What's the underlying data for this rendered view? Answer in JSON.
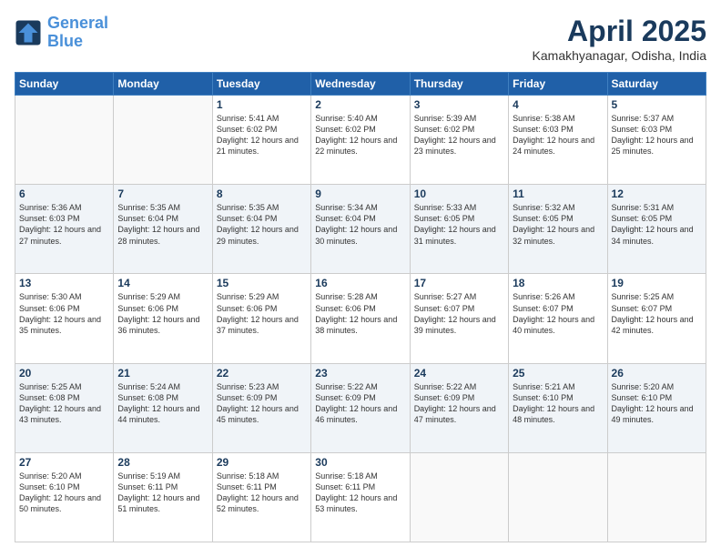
{
  "header": {
    "logo_line1": "General",
    "logo_line2": "Blue",
    "month": "April 2025",
    "location": "Kamakhyanagar, Odisha, India"
  },
  "days_of_week": [
    "Sunday",
    "Monday",
    "Tuesday",
    "Wednesday",
    "Thursday",
    "Friday",
    "Saturday"
  ],
  "weeks": [
    [
      {
        "day": "",
        "text": ""
      },
      {
        "day": "",
        "text": ""
      },
      {
        "day": "1",
        "text": "Sunrise: 5:41 AM\nSunset: 6:02 PM\nDaylight: 12 hours and 21 minutes."
      },
      {
        "day": "2",
        "text": "Sunrise: 5:40 AM\nSunset: 6:02 PM\nDaylight: 12 hours and 22 minutes."
      },
      {
        "day": "3",
        "text": "Sunrise: 5:39 AM\nSunset: 6:02 PM\nDaylight: 12 hours and 23 minutes."
      },
      {
        "day": "4",
        "text": "Sunrise: 5:38 AM\nSunset: 6:03 PM\nDaylight: 12 hours and 24 minutes."
      },
      {
        "day": "5",
        "text": "Sunrise: 5:37 AM\nSunset: 6:03 PM\nDaylight: 12 hours and 25 minutes."
      }
    ],
    [
      {
        "day": "6",
        "text": "Sunrise: 5:36 AM\nSunset: 6:03 PM\nDaylight: 12 hours and 27 minutes."
      },
      {
        "day": "7",
        "text": "Sunrise: 5:35 AM\nSunset: 6:04 PM\nDaylight: 12 hours and 28 minutes."
      },
      {
        "day": "8",
        "text": "Sunrise: 5:35 AM\nSunset: 6:04 PM\nDaylight: 12 hours and 29 minutes."
      },
      {
        "day": "9",
        "text": "Sunrise: 5:34 AM\nSunset: 6:04 PM\nDaylight: 12 hours and 30 minutes."
      },
      {
        "day": "10",
        "text": "Sunrise: 5:33 AM\nSunset: 6:05 PM\nDaylight: 12 hours and 31 minutes."
      },
      {
        "day": "11",
        "text": "Sunrise: 5:32 AM\nSunset: 6:05 PM\nDaylight: 12 hours and 32 minutes."
      },
      {
        "day": "12",
        "text": "Sunrise: 5:31 AM\nSunset: 6:05 PM\nDaylight: 12 hours and 34 minutes."
      }
    ],
    [
      {
        "day": "13",
        "text": "Sunrise: 5:30 AM\nSunset: 6:06 PM\nDaylight: 12 hours and 35 minutes."
      },
      {
        "day": "14",
        "text": "Sunrise: 5:29 AM\nSunset: 6:06 PM\nDaylight: 12 hours and 36 minutes."
      },
      {
        "day": "15",
        "text": "Sunrise: 5:29 AM\nSunset: 6:06 PM\nDaylight: 12 hours and 37 minutes."
      },
      {
        "day": "16",
        "text": "Sunrise: 5:28 AM\nSunset: 6:06 PM\nDaylight: 12 hours and 38 minutes."
      },
      {
        "day": "17",
        "text": "Sunrise: 5:27 AM\nSunset: 6:07 PM\nDaylight: 12 hours and 39 minutes."
      },
      {
        "day": "18",
        "text": "Sunrise: 5:26 AM\nSunset: 6:07 PM\nDaylight: 12 hours and 40 minutes."
      },
      {
        "day": "19",
        "text": "Sunrise: 5:25 AM\nSunset: 6:07 PM\nDaylight: 12 hours and 42 minutes."
      }
    ],
    [
      {
        "day": "20",
        "text": "Sunrise: 5:25 AM\nSunset: 6:08 PM\nDaylight: 12 hours and 43 minutes."
      },
      {
        "day": "21",
        "text": "Sunrise: 5:24 AM\nSunset: 6:08 PM\nDaylight: 12 hours and 44 minutes."
      },
      {
        "day": "22",
        "text": "Sunrise: 5:23 AM\nSunset: 6:09 PM\nDaylight: 12 hours and 45 minutes."
      },
      {
        "day": "23",
        "text": "Sunrise: 5:22 AM\nSunset: 6:09 PM\nDaylight: 12 hours and 46 minutes."
      },
      {
        "day": "24",
        "text": "Sunrise: 5:22 AM\nSunset: 6:09 PM\nDaylight: 12 hours and 47 minutes."
      },
      {
        "day": "25",
        "text": "Sunrise: 5:21 AM\nSunset: 6:10 PM\nDaylight: 12 hours and 48 minutes."
      },
      {
        "day": "26",
        "text": "Sunrise: 5:20 AM\nSunset: 6:10 PM\nDaylight: 12 hours and 49 minutes."
      }
    ],
    [
      {
        "day": "27",
        "text": "Sunrise: 5:20 AM\nSunset: 6:10 PM\nDaylight: 12 hours and 50 minutes."
      },
      {
        "day": "28",
        "text": "Sunrise: 5:19 AM\nSunset: 6:11 PM\nDaylight: 12 hours and 51 minutes."
      },
      {
        "day": "29",
        "text": "Sunrise: 5:18 AM\nSunset: 6:11 PM\nDaylight: 12 hours and 52 minutes."
      },
      {
        "day": "30",
        "text": "Sunrise: 5:18 AM\nSunset: 6:11 PM\nDaylight: 12 hours and 53 minutes."
      },
      {
        "day": "",
        "text": ""
      },
      {
        "day": "",
        "text": ""
      },
      {
        "day": "",
        "text": ""
      }
    ]
  ]
}
